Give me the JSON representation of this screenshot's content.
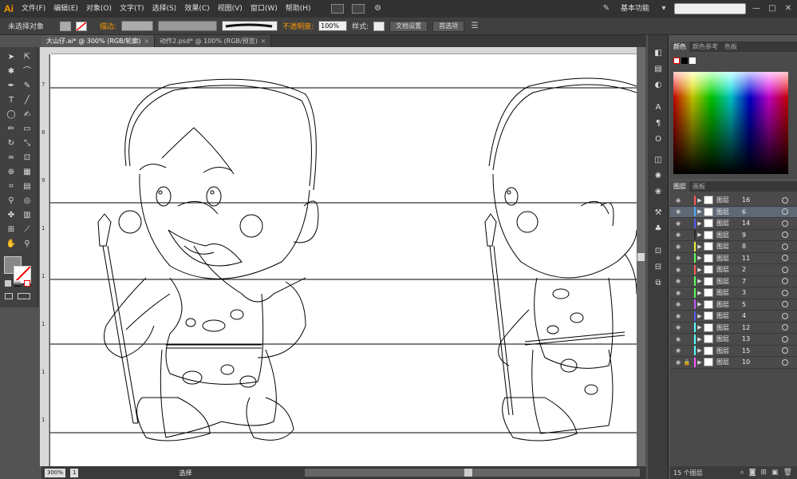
{
  "app": {
    "logo": "Ai"
  },
  "menu": [
    "文件(F)",
    "编辑(E)",
    "对象(O)",
    "文字(T)",
    "选择(S)",
    "效果(C)",
    "视图(V)",
    "窗口(W)",
    "帮助(H)"
  ],
  "workspace": {
    "label": "基本功能",
    "arrow": "▾",
    "minimize": "—",
    "maximize": "□",
    "close": "✕"
  },
  "control": {
    "no_selection": "未选择对象",
    "stroke_label": "描边:",
    "opacity_label": "不透明度:",
    "opacity_value": "100%",
    "style_label": "样式:",
    "doc_settings": "文档设置",
    "preferences": "首选项"
  },
  "tabs": [
    {
      "label": "大山仔.ai* @ 300% (RGB/轮廓)",
      "close": "×"
    },
    {
      "label": "动作2.psd* @ 100% (RGB/预览)",
      "close": "×"
    }
  ],
  "rulers": {
    "left": [
      "7",
      "8",
      "9",
      "1",
      "1",
      "1",
      "1",
      "1"
    ],
    "top": []
  },
  "status": {
    "zoom": "300%",
    "page": "1",
    "tool": "选择"
  },
  "color_panel": {
    "tabs": [
      "颜色",
      "颜色参考",
      "色板"
    ],
    "fill_color": "#ffffff",
    "stroke_color": "#000000"
  },
  "layers_panel": {
    "tabs": [
      "图层",
      "画板"
    ],
    "layers": [
      {
        "name": "图层",
        "num": "16",
        "color": "#ff5a5a",
        "locked": false
      },
      {
        "name": "图层",
        "num": "6",
        "color": "#4fa8ff",
        "locked": false
      },
      {
        "name": "图层",
        "num": "14",
        "color": "#5a5aff",
        "locked": false
      },
      {
        "name": "图层",
        "num": "9",
        "color": "#2a2a2a",
        "locked": false
      },
      {
        "name": "图层",
        "num": "8",
        "color": "#f0f040",
        "locked": false
      },
      {
        "name": "图层",
        "num": "11",
        "color": "#5aff5a",
        "locked": false
      },
      {
        "name": "图层",
        "num": "2",
        "color": "#ff5a5a",
        "locked": false
      },
      {
        "name": "图层",
        "num": "7",
        "color": "#5aff5a",
        "locked": false
      },
      {
        "name": "图层",
        "num": "3",
        "color": "#5aff5a",
        "locked": false
      },
      {
        "name": "图层",
        "num": "5",
        "color": "#c05aff",
        "locked": false
      },
      {
        "name": "图层",
        "num": "4",
        "color": "#5a5aff",
        "locked": false
      },
      {
        "name": "图层",
        "num": "12",
        "color": "#5affff",
        "locked": false
      },
      {
        "name": "图层",
        "num": "13",
        "color": "#5affff",
        "locked": false
      },
      {
        "name": "图层",
        "num": "15",
        "color": "#5affff",
        "locked": false
      },
      {
        "name": "图层",
        "num": "10",
        "color": "#ff5aff",
        "locked": true
      }
    ],
    "footer": "15 个图层"
  }
}
